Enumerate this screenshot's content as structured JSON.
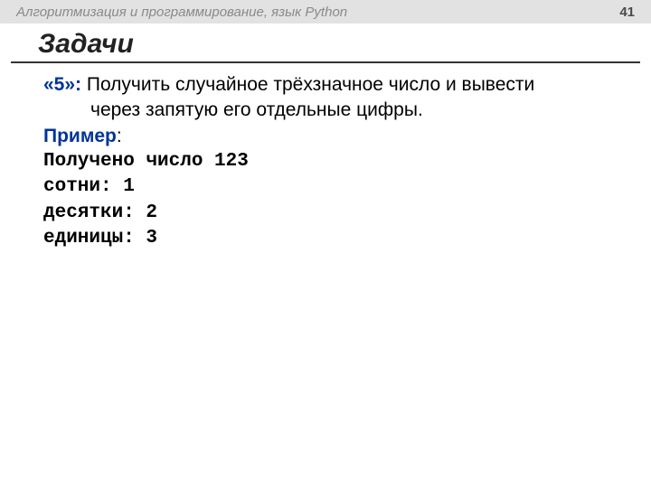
{
  "header": {
    "course_title": "Алгоритмизация и программирование, язык Python",
    "page_number": "41"
  },
  "slide": {
    "title": "Задачи"
  },
  "task": {
    "level_label": "«5»:",
    "description_line1": " Получить случайное трёхзначное число и вывести",
    "description_line2": "через запятую его отдельные цифры.",
    "example_label": "Пример",
    "example_colon": ":",
    "output": {
      "line1": "Получено число 123",
      "line2": "сотни: 1",
      "line3": "десятки: 2",
      "line4": "единицы: 3"
    }
  }
}
